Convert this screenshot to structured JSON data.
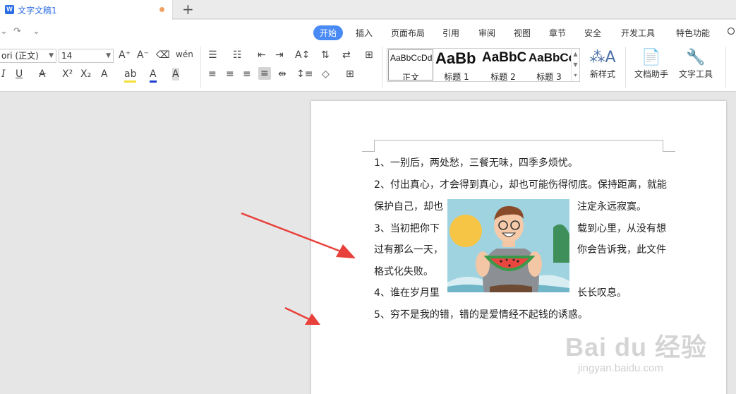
{
  "tabbar": {
    "doc_title": "文字文稿1",
    "new_tab": "+",
    "logo_letter": "W"
  },
  "menubar": {
    "quick": [
      "⌄",
      "↷",
      "⌄"
    ],
    "items": [
      "开始",
      "插入",
      "页面布局",
      "引用",
      "审阅",
      "视图",
      "章节",
      "安全",
      "开发工具",
      "特色功能"
    ],
    "active": "开始",
    "search_icon": "search-icon"
  },
  "ribbon": {
    "font_name": "ori (正文)",
    "font_size": "14",
    "styles": [
      {
        "preview": "AaBbCcDd",
        "name": "正文"
      },
      {
        "preview": "AaBb",
        "name": "标题 1"
      },
      {
        "preview": "AaBbC",
        "name": "标题 2"
      },
      {
        "preview": "AaBbCc",
        "name": "标题 3"
      }
    ],
    "new_style": "新样式",
    "doc_helper": "文档助手",
    "text_tools": "文字工具"
  },
  "document": {
    "lines": [
      "1、一别后，两处愁，三餐无味，四季多烦忧。",
      "2、付出真心，才会得到真心，却也可能伤得彻底。保持距离，就能",
      "保护自己，却也",
      "注定永远寂寞。",
      "3、当初把你下",
      "载到心里，从没有想",
      "过有那么一天，",
      "你会告诉我，此文件",
      "格式化失败。",
      "4、谁在岁月里",
      "长长叹息。",
      "5、穷不是我的错，错的是爱情经不起钱的诱惑。"
    ]
  },
  "watermark": {
    "brand": "Bai du 经验",
    "url": "jingyan.baidu.com"
  },
  "colors": {
    "accent": "#4a8af4",
    "arrow": "#e8403a",
    "tab_title": "#2b6de5"
  }
}
